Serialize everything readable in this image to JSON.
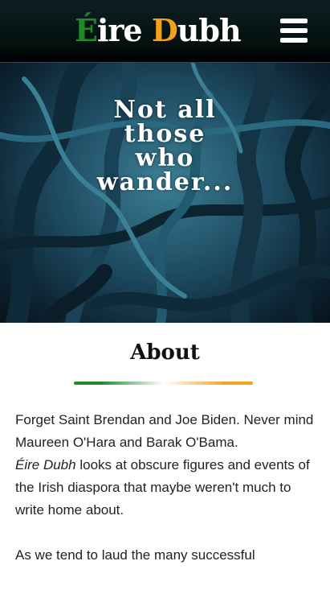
{
  "header": {
    "logo": {
      "part1": "É",
      "part2": "ire ",
      "part3": "D",
      "part4": "ubh"
    },
    "menu_icon": "hamburger-menu-icon"
  },
  "hero": {
    "line1": "Not all",
    "line2": "those",
    "line3": "who",
    "line4": "wander..."
  },
  "about": {
    "heading": "About",
    "p1": "Forget Saint Brendan and Joe Biden. Never mind Maureen O'Hara and Barak O'Bama.",
    "p2_italic": "Éire Dubh",
    "p2_rest": " looks at obscure figures and events of the Irish diaspora that maybe weren't much to write home about.",
    "p3": "As we tend to laud the many successful"
  },
  "colors": {
    "green": "#1f8a2a",
    "orange": "#f2a11c",
    "header_bg": "#05100f"
  }
}
